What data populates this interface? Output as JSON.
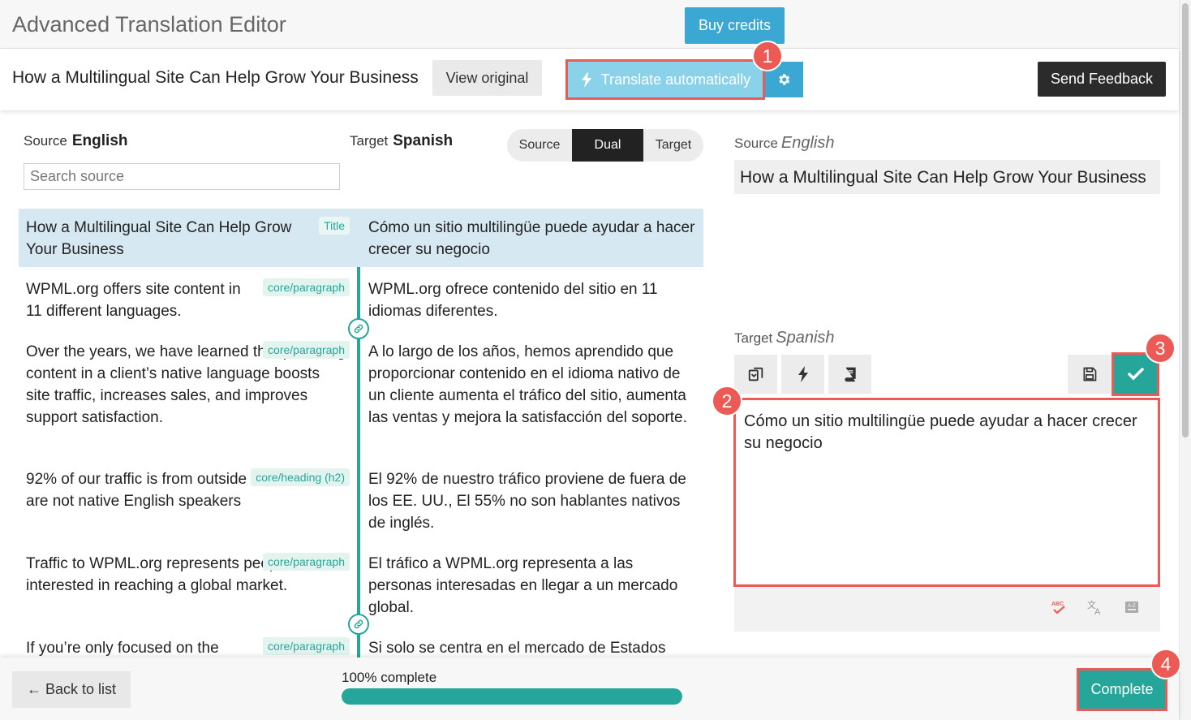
{
  "app": {
    "title": "Advanced Translation Editor",
    "buy_credits": "Buy credits"
  },
  "header": {
    "document_title": "How a Multilingual Site Can Help Grow Your Business",
    "view_original": "View original",
    "translate_automatically": "Translate automatically",
    "send_feedback": "Send Feedback"
  },
  "left_panel": {
    "source_label": "Source",
    "source_language": "English",
    "target_label": "Target",
    "target_language": "Spanish",
    "search_placeholder": "Search source",
    "view_modes": [
      "Source",
      "Dual",
      "Target"
    ],
    "selected_view_mode": "Dual"
  },
  "segments": [
    {
      "source": "How a Multilingual Site Can Help Grow Your Business",
      "tag": "Title",
      "target": "Cómo un sitio multilingüe puede ayudar a hacer crecer su negocio"
    },
    {
      "source": "WPML.org offers site content in 11 different languages.",
      "tag": "core/paragraph",
      "target": "WPML.org ofrece contenido del sitio en 11 idiomas diferentes."
    },
    {
      "source": "Over the years, we have learned that providing content in a client’s native language boosts site traffic, increases sales, and improves support satisfaction.",
      "tag": "core/paragraph",
      "target": "A lo largo de los años, hemos aprendido que proporcionar contenido en el idioma nativo de un cliente aumenta el tráfico del sitio, aumenta las ventas y mejora la satisfacción del soporte."
    },
    {
      "source": "92% of our traffic is from outside the US, 55% are not native English speakers",
      "tag": "core/heading (h2)",
      "target": "El 92% de nuestro tráfico proviene de fuera de los EE. UU., El 55% no son hablantes nativos de inglés."
    },
    {
      "source": "Traffic to WPML.org represents people interested in reaching a global market.",
      "tag": "core/paragraph",
      "target": "El tráfico a WPML.org representa a las personas interesadas en llegar a un mercado global."
    },
    {
      "source": "If you’re only focused on the",
      "tag": "core/paragraph",
      "target": "Si solo se centra en el mercado de Estados"
    }
  ],
  "right_panel": {
    "source_label": "Source",
    "source_language": "English",
    "source_text": "How a Multilingual Site Can Help Grow Your Business",
    "target_label": "Target",
    "target_language": "Spanish",
    "target_text": "Cómo un sitio multilingüe puede ayudar a hacer crecer su negocio"
  },
  "callouts": [
    "1",
    "2",
    "3",
    "4"
  ],
  "footer": {
    "back_to_list": "← Back to list",
    "progress_label": "100% complete",
    "progress_value": 1.0,
    "complete": "Complete"
  },
  "colors": {
    "accent_blue": "#3aa8d3",
    "teal": "#26a69a",
    "highlight_red": "#ec5a55",
    "dark": "#2b2b2b"
  },
  "icons": {
    "translate_automatically": "lightning-icon",
    "settings": "gear-icon",
    "copy": "copy-icon",
    "machine_translate": "lightning-icon",
    "glossary": "book-icon",
    "save": "save-icon",
    "confirm": "checkmark-icon",
    "spellcheck": "spellcheck-icon",
    "language": "translate-icon",
    "dictionary": "dictionary-icon",
    "segment_link": "link-icon"
  }
}
